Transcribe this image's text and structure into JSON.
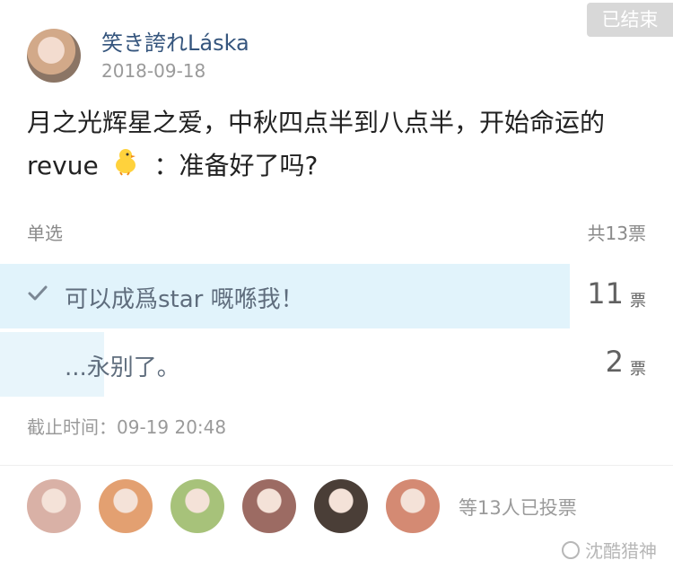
{
  "post": {
    "status_badge": "已结束",
    "username": "笑き誇れLáska",
    "date": "2018-09-18",
    "content_part1": "月之光辉星之爱，中秋四点半到八点半，开始命运的revue",
    "content_part2": "：准备好了吗?",
    "chick_icon": "chick-emoji-icon"
  },
  "poll": {
    "type_label": "单选",
    "total_votes": "共13票",
    "options": [
      {
        "label": "可以成爲star 嘅喺我！",
        "count": "11",
        "unit": "票",
        "share": 0.846,
        "selected": true
      },
      {
        "label": "...永别了。",
        "count": "2",
        "unit": "票",
        "share": 0.154,
        "selected": false
      }
    ],
    "deadline": "截止时间：09-19 20:48"
  },
  "voters": {
    "summary": "等13人已投票",
    "avatar_colors": [
      "#d9b1a6",
      "#e3a071",
      "#a7c27a",
      "#9c6b63",
      "#4a3e37",
      "#d48a73"
    ]
  },
  "watermark": "沈酷猎神",
  "colors": {
    "accent_text": "#35557d",
    "bar_selected": "#e1f3fb",
    "bar_other": "#e8f5fb"
  }
}
